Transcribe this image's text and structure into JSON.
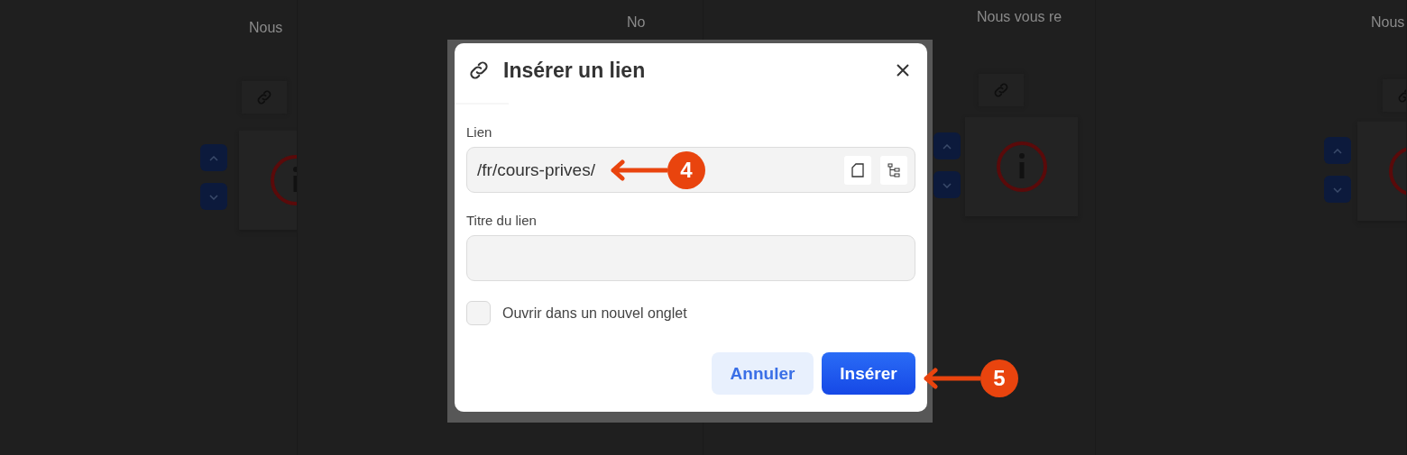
{
  "background_columns": [
    {
      "heading": "Nous"
    },
    {
      "heading": "No"
    },
    {
      "heading": "Nous vous re"
    },
    {
      "heading": "Nous"
    }
  ],
  "dialog": {
    "title": "Insérer un lien",
    "fields": [
      {
        "label": "Lien",
        "value": "/fr/cours-prives/",
        "kind": "url"
      },
      {
        "label": "Titre du lien",
        "kind": "text"
      }
    ],
    "new_tab": {
      "label": "Ouvrir dans un nouvel onglet",
      "checked": false
    },
    "buttons": [
      {
        "label": "Annuler",
        "kind": "secondary"
      },
      {
        "label": "Insérer",
        "kind": "primary"
      }
    ]
  },
  "annotations": [
    {
      "label": "4"
    },
    {
      "label": "5"
    }
  ]
}
